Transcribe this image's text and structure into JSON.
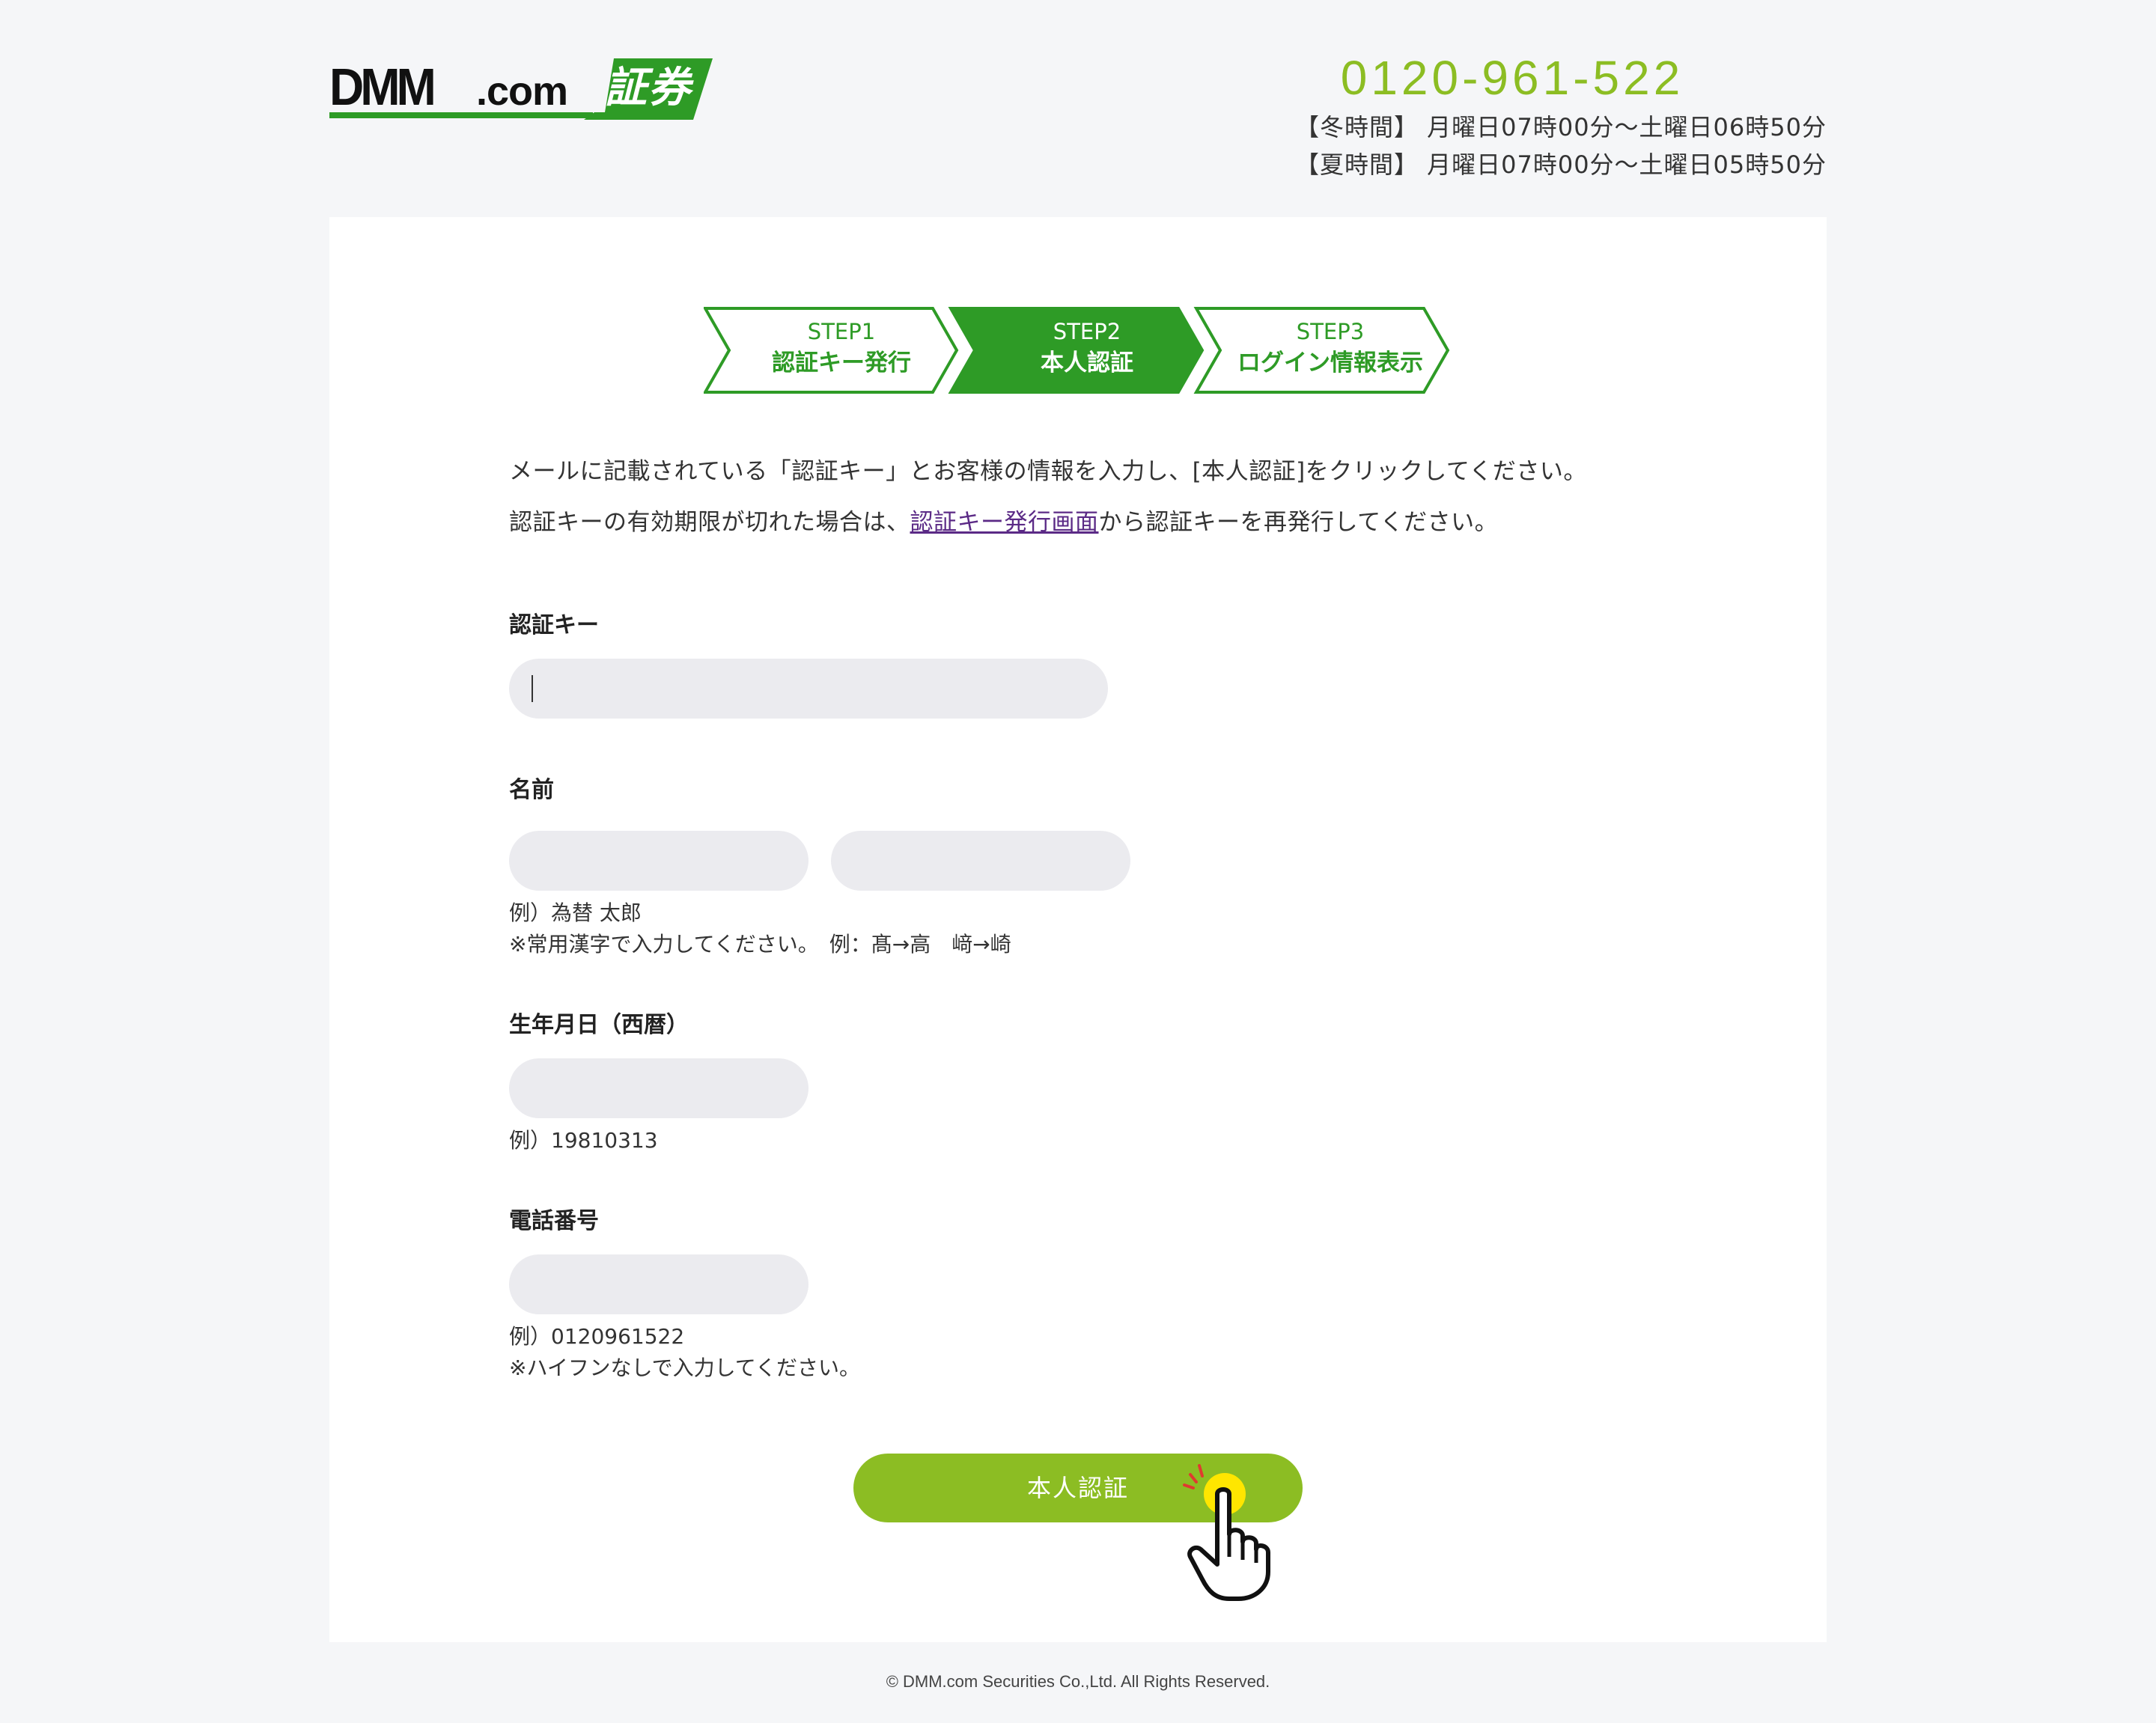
{
  "header": {
    "logo_text": "DMM.com",
    "logo_badge": "証券",
    "phone": "0120-961-522",
    "winter_hours": "【冬時間】 月曜日07時00分～土曜日06時50分",
    "summer_hours": "【夏時間】 月曜日07時00分～土曜日05時50分"
  },
  "steps": [
    {
      "num": "STEP1",
      "name": "認証キー発行",
      "active": false
    },
    {
      "num": "STEP2",
      "name": "本人認証",
      "active": true
    },
    {
      "num": "STEP3",
      "name": "ログイン情報表示",
      "active": false
    }
  ],
  "intro": {
    "line1": "メールに記載されている「認証キー」とお客様の情報を入力し、[本人認証]をクリックしてください。",
    "line2_before": "認証キーの有効期限が切れた場合は、",
    "line2_link": "認証キー発行画面",
    "line2_after": "から認証キーを再発行してください。"
  },
  "form": {
    "auth_key": {
      "label": "認証キー",
      "value": ""
    },
    "name": {
      "label": "名前",
      "last_value": "",
      "first_value": "",
      "example": "例）為替 太郎",
      "note": "※常用漢字で入力してください。　例：髙→高　﨑→崎"
    },
    "birthdate": {
      "label": "生年月日（西暦）",
      "value": "",
      "example": "例）19810313"
    },
    "phone": {
      "label": "電話番号",
      "value": "",
      "example": "例）0120961522",
      "note": "※ハイフンなしで入力してください。"
    },
    "submit_label": "本人認証"
  },
  "footer": {
    "copyright": "© DMM.com Securities Co.,Ltd. All Rights Reserved."
  },
  "colors": {
    "brand_green": "#2e9b26",
    "accent_green": "#8cbd23",
    "input_bg": "#ebebef",
    "page_bg": "#f5f6f8",
    "link": "#5b2a86"
  },
  "icons": {
    "cursor": "pointing-hand-icon"
  }
}
